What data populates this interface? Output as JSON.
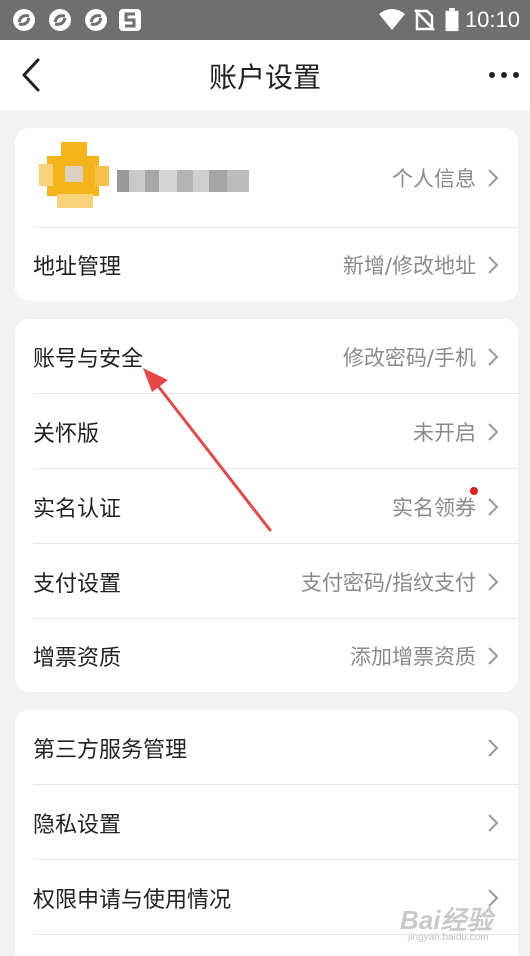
{
  "status_bar": {
    "time": "10:10",
    "icons": [
      "app-icon",
      "app-icon",
      "app-icon",
      "app-icon",
      "wifi-icon",
      "no-sim-icon",
      "battery-icon"
    ]
  },
  "navbar": {
    "title": "账户设置"
  },
  "profile_card": {
    "profile_value": "个人信息",
    "address_label": "地址管理",
    "address_value": "新增/修改地址"
  },
  "security_card": {
    "items": [
      {
        "label": "账号与安全",
        "value": "修改密码/手机"
      },
      {
        "label": "关怀版",
        "value": "未开启"
      },
      {
        "label": "实名认证",
        "value": "实名领券"
      },
      {
        "label": "支付设置",
        "value": "支付密码/指纹支付"
      },
      {
        "label": "增票资质",
        "value": "添加增票资质"
      }
    ]
  },
  "services_card": {
    "items": [
      {
        "label": "第三方服务管理",
        "value": ""
      },
      {
        "label": "隐私设置",
        "value": ""
      },
      {
        "label": "权限申请与使用情况",
        "value": ""
      }
    ]
  },
  "colors": {
    "status_bar": "#6f6f6f",
    "background": "#f2f2f2",
    "annotation_arrow": "#e8474a",
    "red_dot": "#e02020",
    "avatar": "#f5b51a"
  },
  "watermark": {
    "main": "Bai经验",
    "sub": "jingyan.baidu.com"
  }
}
